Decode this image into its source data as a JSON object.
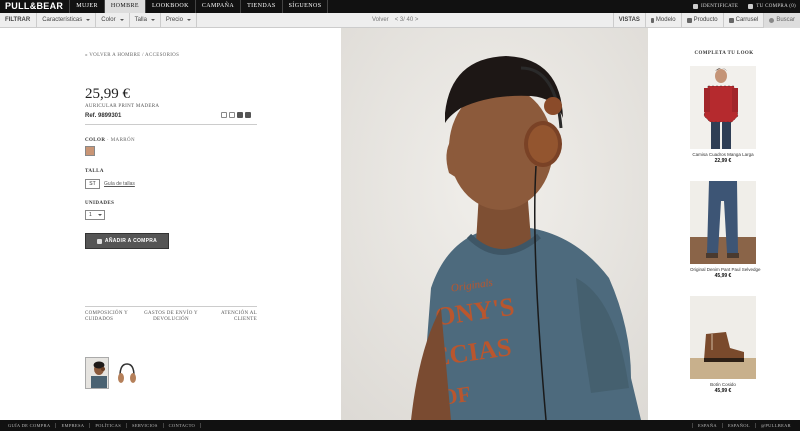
{
  "header": {
    "logo": "PULL&BEAR",
    "nav": [
      "MUJER",
      "HOMBRE",
      "LOOKBOOK",
      "CAMPAÑA",
      "TIENDAS",
      "SÍGUENOS"
    ],
    "active_nav": "HOMBRE",
    "login": "IDENTIFICATE",
    "cart": "TU COMPRA (0)"
  },
  "filterbar": {
    "label": "FILTRAR",
    "filters": [
      "Características",
      "Color",
      "Talla",
      "Precio"
    ],
    "back": "Volver",
    "pager": "< 3/ 40 >",
    "views_label": "VISTAS",
    "view_modelo": "Modelo",
    "view_producto": "Producto",
    "view_carrusel": "Carrusel",
    "search": "Buscar"
  },
  "product": {
    "breadcrumb": "« VOLVER A HOMBRE / ACCESORIOS",
    "price": "25,99 €",
    "name": "AURICULAR PRINT MADERA",
    "ref": "Ref. 9899301",
    "color_label": "COLOR",
    "color_value": "· MARRÓN",
    "color_swatch": "#c99575",
    "size_label": "TALLA",
    "size_value": "ST",
    "size_guide": "Guía de tallas",
    "units_label": "UNIDADES",
    "units_value": "1",
    "add_button": "AÑADIR A COMPRA",
    "info_links": [
      "COMPOSICIÓN Y CUIDADOS",
      "GASTOS DE ENVÍO Y DEVOLUCIÓN",
      "ATENCIÓN AL CLIENTE"
    ]
  },
  "complete_look": {
    "title": "COMPLETA TU LOOK",
    "items": [
      {
        "name": "Camisa Cuadros Manga Larga",
        "price": "22,99 €"
      },
      {
        "name": "Original Denim Pant Paul Selvedge",
        "price": "45,99 €"
      },
      {
        "name": "Botín Cosido",
        "price": "45,99 €"
      }
    ]
  },
  "footer": {
    "left": [
      "GUÍA DE COMPRA",
      "EMPRESA",
      "POLÍTICAS",
      "SERVICIOS",
      "CONTACTO"
    ],
    "right": [
      "ESPAÑA",
      "ESPAÑOL",
      "@PULLBEAR"
    ]
  }
}
